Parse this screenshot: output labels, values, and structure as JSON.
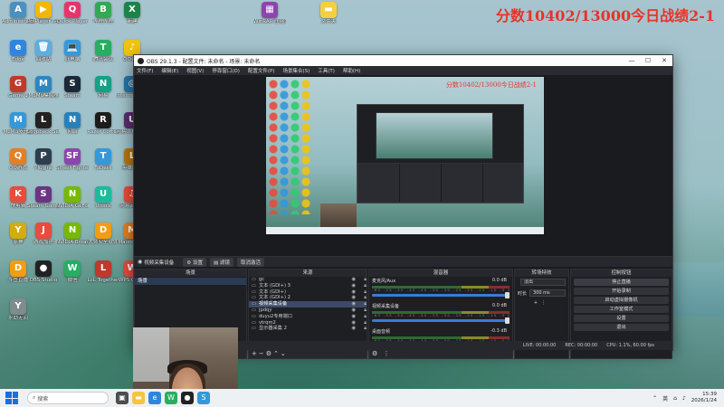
{
  "overlay_title": "分数10402/13000今日战绩2-1",
  "desktop_icons": [
    {
      "label": "Administrator",
      "color": "#4a90c2",
      "glyph": "A"
    },
    {
      "label": "PotPlayer 64 bit",
      "color": "#f2b705",
      "glyph": "▶"
    },
    {
      "label": "Quick Player",
      "color": "#e8336b",
      "glyph": "Q"
    },
    {
      "label": "哔哩哔哩",
      "color": "#34a853",
      "glyph": "B"
    },
    {
      "label": "新建",
      "color": "#1d8348",
      "glyph": "X"
    },
    {
      "label": "Edge",
      "color": "#2e86de",
      "glyph": "e"
    },
    {
      "label": "回收站",
      "color": "#5dade2",
      "glyph": "🗑"
    },
    {
      "label": "此电脑",
      "color": "#3498db",
      "glyph": "💻"
    },
    {
      "label": "腾讯会议",
      "color": "#27ae60",
      "glyph": "T"
    },
    {
      "label": "QQ音乐",
      "color": "#f1c40f",
      "glyph": "♪"
    },
    {
      "label": "Game 1",
      "color": "#c0392b",
      "glyph": "G"
    },
    {
      "label": "MuMu模拟器",
      "color": "#2e86c1",
      "glyph": "M"
    },
    {
      "label": "Steam",
      "color": "#1b2838",
      "glyph": "S"
    },
    {
      "label": "网易",
      "color": "#16a085",
      "glyph": "N"
    },
    {
      "label": "Internet Connection",
      "color": "#2874a6",
      "glyph": "◎"
    },
    {
      "label": "MuMu多开器",
      "color": "#3498db",
      "glyph": "M"
    },
    {
      "label": "Loopback Settings",
      "color": "#222",
      "glyph": "L"
    },
    {
      "label": "网络",
      "color": "#2980b9",
      "glyph": "N"
    },
    {
      "label": "Razer Cortex",
      "color": "#1c1c1c",
      "glyph": "R"
    },
    {
      "label": "网易UU加速器",
      "color": "#5b2c6f",
      "glyph": "U"
    },
    {
      "label": "QQ游戏",
      "color": "#e67e22",
      "glyph": "Q"
    },
    {
      "label": "Plugins",
      "color": "#2c3e50",
      "glyph": "P"
    },
    {
      "label": "Street Fighter 6",
      "color": "#8e44ad",
      "glyph": "SF"
    },
    {
      "label": "ToDesk",
      "color": "#3498db",
      "glyph": "T"
    },
    {
      "label": "英雄联盟",
      "color": "#b9770e",
      "glyph": "L"
    },
    {
      "label": "快剪辑",
      "color": "#e74c3c",
      "glyph": "K"
    },
    {
      "label": "Steam Game",
      "color": "#6c3483",
      "glyph": "S"
    },
    {
      "label": "NVIDIA GeForce",
      "color": "#76b900",
      "glyph": "N"
    },
    {
      "label": "Utools",
      "color": "#1abc9c",
      "glyph": "U"
    },
    {
      "label": "网易云音乐",
      "color": "#e74c3c",
      "glyph": "♫"
    },
    {
      "label": "原神",
      "color": "#d4ac0d",
      "glyph": "Y"
    },
    {
      "label": "游戏加速",
      "color": "#e74c3c",
      "glyph": "J"
    },
    {
      "label": "NVIDIA Broadcast",
      "color": "#76b900",
      "glyph": "N"
    },
    {
      "label": "大师安全软件",
      "color": "#f39c12",
      "glyph": "D"
    },
    {
      "label": "Maono Link",
      "color": "#e67e22",
      "glyph": "M"
    },
    {
      "label": "斗鱼直播",
      "color": "#f39c12",
      "glyph": "D"
    },
    {
      "label": "OBS Studio",
      "color": "#222",
      "glyph": "●"
    },
    {
      "label": "微信",
      "color": "#27ae60",
      "glyph": "W"
    },
    {
      "label": "LoL Together",
      "color": "#c0392b",
      "glyph": "L"
    },
    {
      "label": "WPS Office",
      "color": "#e74c3c",
      "glyph": "W"
    },
    {
      "label": "永劫无间",
      "color": "#7f8c8d",
      "glyph": "Y"
    }
  ],
  "top_icons": [
    {
      "label": "WinRAR 压缩文件",
      "color": "#8e44ad",
      "glyph": "▦"
    },
    {
      "label": "文件夹",
      "color": "#f4d03f",
      "glyph": "▬"
    }
  ],
  "obs": {
    "title": "OBS 29.1.3 - 配置文件: 未命名 - 场景: 未命名",
    "menu": [
      "文件(F)",
      "编辑(E)",
      "视图(V)",
      "停靠窗口(D)",
      "配置文件(P)",
      "场景集合(S)",
      "工具(T)",
      "帮助(H)"
    ],
    "preview_title": "分数10402/13000今日战绩2-1",
    "source_bar": {
      "source": "视频采集设备",
      "props": "设置",
      "filters": "滤镜",
      "deactivate": "取消激活"
    },
    "scenes": {
      "header": "场景",
      "items": [
        "场景"
      ]
    },
    "sources": {
      "header": "来源",
      "items": [
        {
          "name": "gc",
          "selected": false
        },
        {
          "name": "文本 (GDI+) 3",
          "selected": false
        },
        {
          "name": "文本 (GDI+)",
          "selected": false
        },
        {
          "name": "文本 (GDI+) 2",
          "selected": false
        },
        {
          "name": "视频采集设备",
          "selected": true
        },
        {
          "name": "jpdqy",
          "selected": false
        },
        {
          "name": "duyu2专用端口",
          "selected": false
        },
        {
          "name": "vtrqm2",
          "selected": false
        },
        {
          "name": "显示器采集 2",
          "selected": false
        }
      ]
    },
    "mixer": {
      "header": "混音器",
      "channels": [
        {
          "name": "麦克风/Aux",
          "db": "0.0 dB"
        },
        {
          "name": "视频采集设备",
          "db": "0.0 dB"
        },
        {
          "name": "桌面音频",
          "db": "-0.3 dB"
        }
      ],
      "scale": "-60 -55 -50 -45 -40 -35 -30 -25 -20 -15 -10 -5 0"
    },
    "transitions": {
      "header": "转场特效",
      "type": "淡出",
      "duration_label": "时长",
      "duration": "300 ms"
    },
    "controls": {
      "header": "控制按钮",
      "buttons": [
        "停止直播",
        "开始录制",
        "启动虚拟摄像机",
        "工作室模式",
        "设置",
        "退出"
      ]
    },
    "status": {
      "live": "LIVE: 00:00:00",
      "rec": "REC: 00:00:00",
      "cpu": "CPU: 1.1%, 60.00 fps"
    }
  },
  "taskbar": {
    "search_placeholder": "搜索",
    "tray_lang": "英",
    "time": "15:39",
    "date": "2026/1/24"
  }
}
